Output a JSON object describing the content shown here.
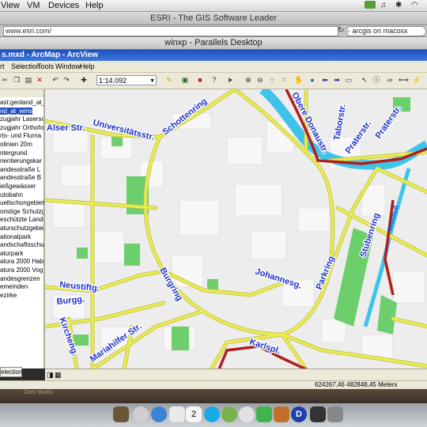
{
  "mac_menubar": {
    "items": [
      "View",
      "VM",
      "Devices",
      "Help"
    ]
  },
  "browser": {
    "title": "ESRI - The GIS Software Leader",
    "url": "www.esri.com/",
    "search": "arcgis on macosx"
  },
  "parallels": {
    "title": "winxp - Parallels Desktop"
  },
  "arcmap": {
    "title": "s.mxd - ArcMap - ArcView",
    "menu": [
      "rt",
      "Selection",
      "Tools",
      "Window",
      "Help"
    ],
    "scale": "1:14.092"
  },
  "toc": {
    "items": [
      "ast:geoland_at_",
      "nd_at_wms",
      "zugjahr Laserso",
      "zugjahr Orthofo",
      "rts- und Flurna",
      "olinien 20m",
      "ntergrund",
      "rientierungskar",
      "andesstraße L",
      "andesstraße B",
      "ießgewässer",
      "utobahn",
      "uellschongebiet",
      "onstige Schutzg",
      "eschützte Lands",
      "aturschutzgebie",
      "ationalpark",
      "andschaftsschu",
      "aturpark",
      "atura 2000 Hab",
      "atura 2000 Vog",
      "andesgrenzen",
      "emeinden",
      "ezirke"
    ],
    "selected_index": 1,
    "tab": "election"
  },
  "map": {
    "coords": "624267,46  482848,45 Meters",
    "colors": {
      "background": "#ededed",
      "road": "#ecec4c",
      "road_edge": "#c6c65a",
      "park": "#6ccf6c",
      "canal": "#3ec3ea",
      "red_route": "#b01e1e",
      "label": "#1c31c9"
    },
    "labels": [
      "Alser Str.",
      "Universitätsstr.",
      "Schottenring",
      "Obere Donaustr.",
      "Taborstr.",
      "Praterstr.",
      "Praterstr.",
      "Stubenring",
      "Neustiftg.",
      "Burgg.",
      "Burgring",
      "Johannesg.",
      "Parkring",
      "Kircheng.",
      "Mariahilfer Str.",
      "Karlspl.",
      "Wienfluß"
    ]
  },
  "desktop": {
    "caro": "Caro Studio"
  }
}
